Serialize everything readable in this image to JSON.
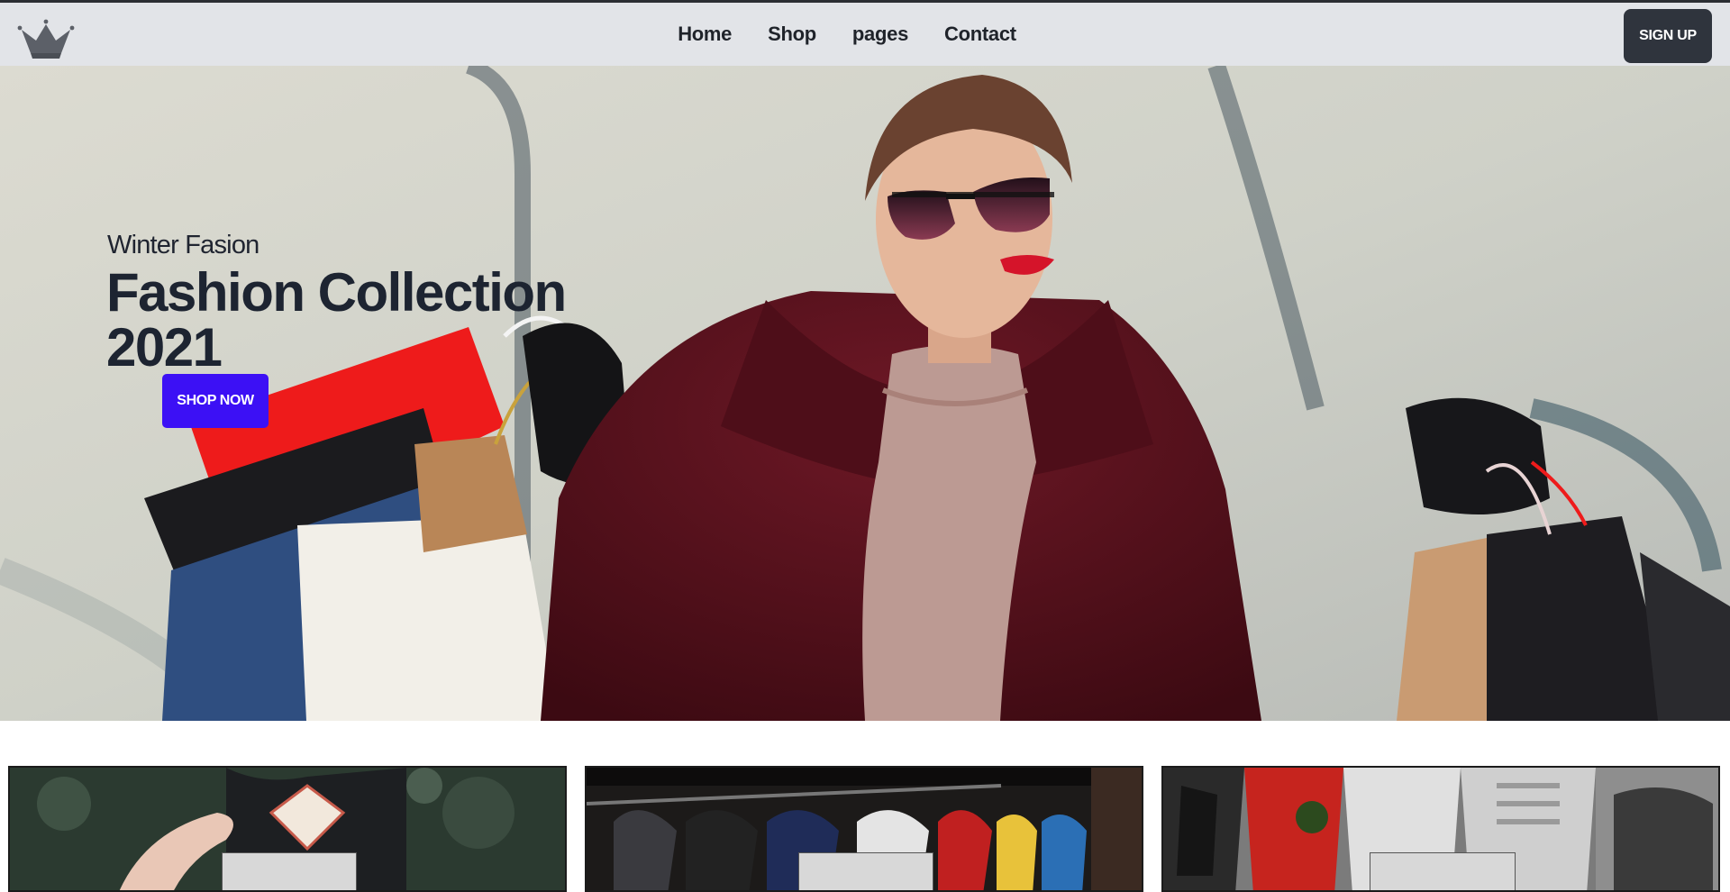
{
  "header": {
    "logo_icon": "crown-icon",
    "nav": [
      {
        "label": "Home"
      },
      {
        "label": "Shop"
      },
      {
        "label": "pages"
      },
      {
        "label": "Contact"
      }
    ],
    "signup_label": "SIGN UP"
  },
  "hero": {
    "subtitle": "Winter Fasion",
    "title_line1": "Fashion Collection",
    "title_line2": "2021",
    "cta_label": "SHOP NOW",
    "cta_color": "#3c10f5"
  },
  "categories": [
    {
      "image": "cap-photo"
    },
    {
      "image": "clothes-rack-photo"
    },
    {
      "image": "sneakers-photo"
    }
  ],
  "colors": {
    "navbar_bg": "#e2e4e8",
    "signup_bg": "#2f343d",
    "title_text": "#1d2431"
  }
}
